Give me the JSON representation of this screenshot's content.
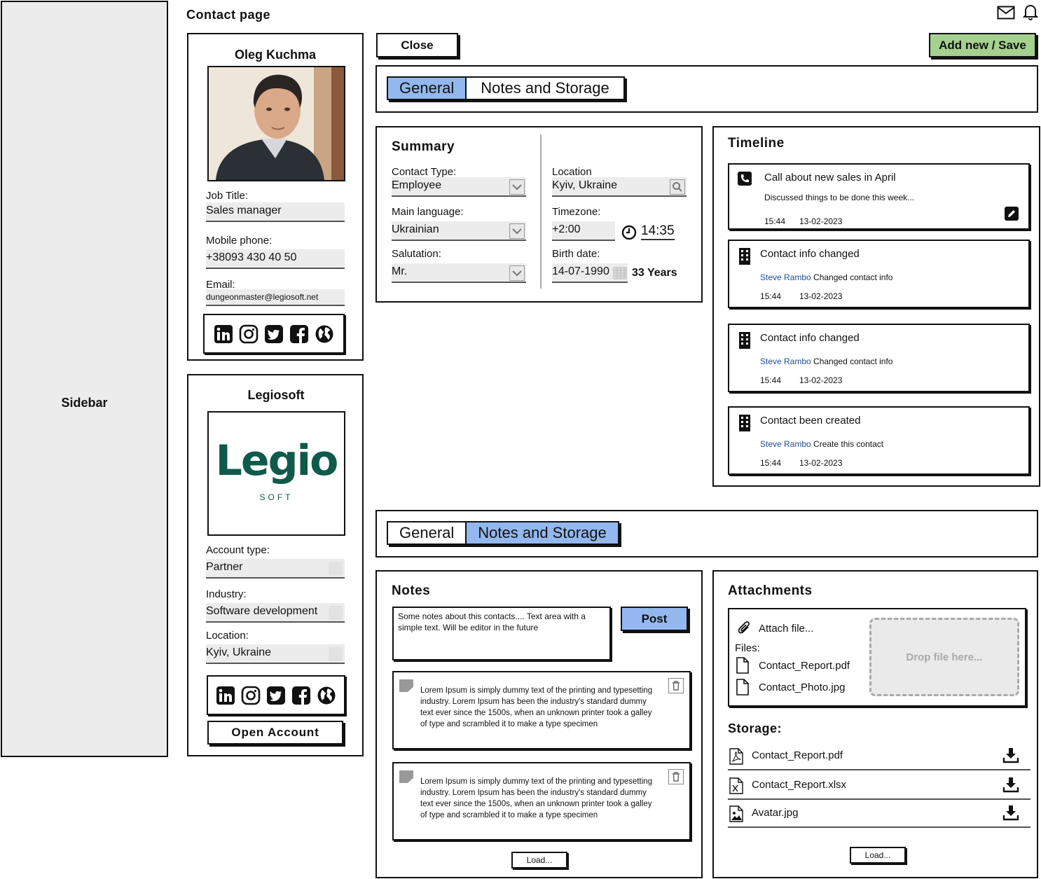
{
  "sidebar": {
    "label": "Sidebar"
  },
  "page_title": "Contact page",
  "header_icons": {
    "mail": "mail-icon",
    "bell": "bell-icon"
  },
  "contact": {
    "name": "Oleg Kuchma",
    "job_title_label": "Job Title:",
    "job_title": "Sales manager",
    "mobile_label": "Mobile phone:",
    "mobile": "+38093 430 40 50",
    "email_label": "Email:",
    "email": "dungeonmaster@legiosoft.net"
  },
  "company": {
    "name": "Legiosoft",
    "logo_text": "Legio",
    "logo_sub": "SOFT",
    "account_type_label": "Account type:",
    "account_type": "Partner",
    "industry_label": "Industry:",
    "industry": "Software development",
    "location_label": "Location:",
    "location": "Kyiv, Ukraine",
    "open_account": "Open Account"
  },
  "actions": {
    "close": "Close",
    "save": "Add new / Save"
  },
  "tabs": {
    "general": "General",
    "notes": "Notes and Storage"
  },
  "summary": {
    "title": "Summary",
    "contact_type_label": "Contact Type:",
    "contact_type": "Employee",
    "main_language_label": "Main language:",
    "main_language": "Ukrainian",
    "salutation_label": "Salutation:",
    "salutation": "Mr.",
    "location_label": "Location",
    "location": "Kyiv, Ukraine",
    "timezone_label": "Timezone:",
    "timezone": "+2:00",
    "local_time": "14:35",
    "birth_label": "Birth date:",
    "birth_date": "14-07-1990",
    "age": "33 Years"
  },
  "timeline": {
    "title": "Timeline",
    "items": [
      {
        "title": "Call about new sales in April",
        "subtitle": "Discussed things to be done this week...",
        "user": "",
        "time": "15:44",
        "date": "13-02-2023"
      },
      {
        "title": "Contact info changed",
        "user": "Steve Rambo",
        "action": "Changed contact info",
        "time": "15:44",
        "date": "13-02-2023"
      },
      {
        "title": "Contact info changed",
        "user": "Steve Rambo",
        "action": "Changed contact info",
        "time": "15:44",
        "date": "13-02-2023"
      },
      {
        "title": "Contact been created",
        "user": "Steve Rambo",
        "action": "Create this contact",
        "time": "15:44",
        "date": "13-02-2023"
      }
    ]
  },
  "notes": {
    "title": "Notes",
    "editor_text": "Some notes about this contacts.... Text area with a simple text. Will be editor in the future",
    "post": "Post",
    "items": [
      {
        "text": "Lorem Ipsum is simply dummy text of the printing and typesetting industry. Lorem Ipsum has been the industry's standard dummy text ever since the 1500s, when an unknown printer took a galley of type and scrambled it to make a type specimen"
      },
      {
        "text": "Lorem Ipsum is simply dummy text of the printing and typesetting industry. Lorem Ipsum has been the industry's standard dummy text ever since the 1500s, when an unknown printer took a galley of type and scrambled it to make a type specimen"
      }
    ],
    "load": "Load..."
  },
  "attachments": {
    "title": "Attachments",
    "attach": "Attach file...",
    "files_label": "Files:",
    "files": [
      "Contact_Report.pdf",
      "Contact_Photo.jpg"
    ],
    "drop": "Drop file here...",
    "storage_title": "Storage:",
    "storage": [
      "Contact_Report.pdf",
      "Contact_Report.xlsx",
      "Avatar.jpg"
    ],
    "load": "Load..."
  }
}
